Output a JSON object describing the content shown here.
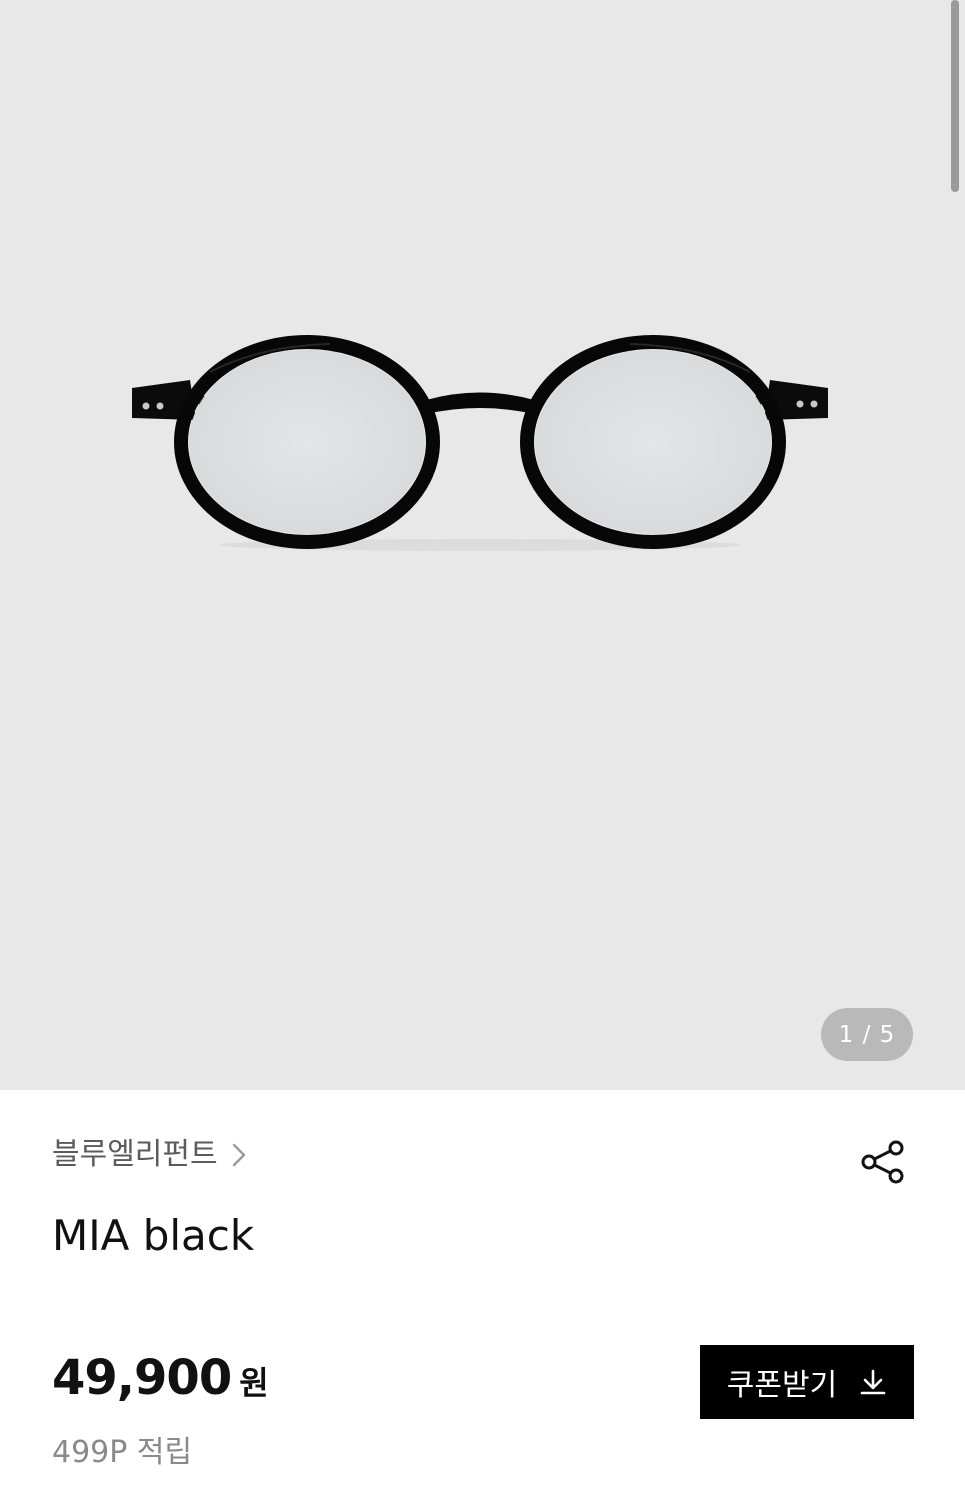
{
  "gallery": {
    "image_alt": "MIA black eyeglasses",
    "pager": {
      "current": 1,
      "total": 5,
      "text": "1 / 5"
    }
  },
  "product": {
    "brand": "블루엘리펀트",
    "title": "MIA black",
    "price": "49,900",
    "currency": "원",
    "points": "499P 적립"
  },
  "actions": {
    "coupon_label": "쿠폰받기"
  },
  "icons": {
    "brand_chevron": "chevron-right-icon",
    "share": "share-icon",
    "coupon": "download-icon"
  },
  "colors": {
    "gallery_bg": "#e8e8e9",
    "pager_bg": "#b9b9ba",
    "coupon_bg": "#000000",
    "text_primary": "#111111",
    "text_secondary": "#8a8a8a"
  }
}
